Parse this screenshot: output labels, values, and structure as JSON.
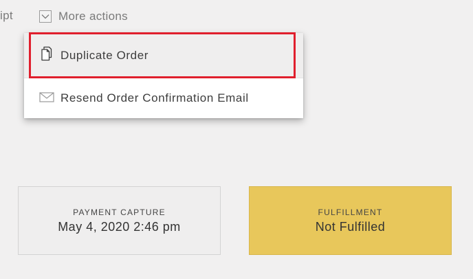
{
  "toolbar": {
    "receipt_partial": "ipt",
    "more_actions_label": "More actions",
    "more_actions_icon": "chevron-down-icon"
  },
  "dropdown": {
    "items": [
      {
        "label": "Duplicate Order",
        "icon": "duplicate-icon",
        "highlighted": true
      },
      {
        "label": "Resend Order Confirmation Email",
        "icon": "envelope-icon",
        "highlighted": false
      }
    ],
    "highlight_color": "#e01f2d"
  },
  "status_cards": [
    {
      "label": "PAYMENT CAPTURE",
      "value": "May 4, 2020 2:46 pm",
      "background": "#efeeee"
    },
    {
      "label": "FULFILLMENT",
      "value": "Not Fulfilled",
      "background": "#e8c75b"
    }
  ]
}
